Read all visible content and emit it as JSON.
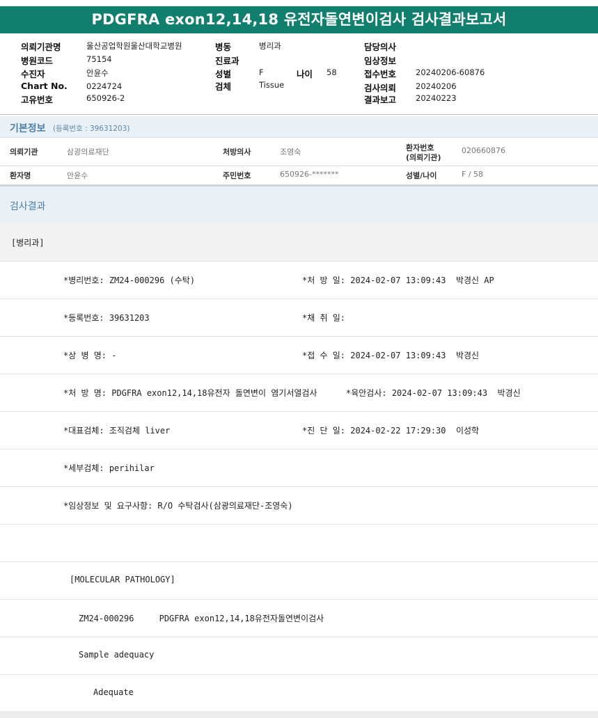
{
  "title": "PDGFRA exon12,14,18 유전자돌연변이검사 검사결과보고서",
  "header": {
    "col1": [
      {
        "label": "의뢰기관명",
        "value": "울산공업학원울산대학교병원"
      },
      {
        "label": "병원코드",
        "value": "75154"
      },
      {
        "label": "수진자",
        "value": "안윤수"
      },
      {
        "label": "Chart No.",
        "value": "0224724"
      },
      {
        "label": "고유번호",
        "value": "650926-2"
      }
    ],
    "col2": [
      {
        "label": "병동",
        "value": "병리과"
      },
      {
        "label": "진료과",
        "value": ""
      },
      {
        "label": "성별",
        "value": "F"
      },
      {
        "label": "검체",
        "value": "Tissue"
      }
    ],
    "age": {
      "label": "나이",
      "value": "58"
    },
    "col3": [
      {
        "label": "담당의사",
        "value": ""
      },
      {
        "label": "임상정보",
        "value": ""
      },
      {
        "label": "접수번호",
        "value": "20240206-60876"
      },
      {
        "label": "검사의뢰",
        "value": "20240206"
      },
      {
        "label": "결과보고",
        "value": "20240223"
      }
    ]
  },
  "basic": {
    "title": "기본정보",
    "reg": "(등록번호 : 39631203)",
    "row1": [
      {
        "label": "의뢰기관",
        "value": "삼광의료재단"
      },
      {
        "label": "처방의사",
        "value": "조영숙"
      },
      {
        "label_line1": "환자번호",
        "label_line2": "(의뢰기관)",
        "value": "020660876"
      }
    ],
    "row2": [
      {
        "label": "환자명",
        "value": "안윤수"
      },
      {
        "label": "주민번호",
        "value": "650926-*******"
      },
      {
        "label": "성별/나이",
        "value": "F / 58"
      }
    ]
  },
  "result": {
    "title": "검사결과",
    "dept": "[병리과]",
    "rows": [
      {
        "left": "*병리번호: ZM24-000296 (수탁)",
        "right": "*처 방 일: 2024-02-07 13:09:43  박경신 AP"
      },
      {
        "left": "*등록번호: 39631203",
        "right": "*채 취 일:"
      },
      {
        "left": "*상 병 명: -",
        "right": "*접 수 일: 2024-02-07 13:09:43  박경신"
      },
      {
        "left": "*처 방 명: PDGFRA exon12,14,18유전자 돌연변이 염기서열검사",
        "right": "*육안검사: 2024-02-07 13:09:43  박경신"
      },
      {
        "left": "*대표검체: 조직검체 liver",
        "right": "*진 단 일: 2024-02-22 17:29:30  이성학"
      },
      {
        "left": "*세부검체: perihilar",
        "right": ""
      },
      {
        "left": "*임상정보 및 요구사항: R/O 수탁검사(삼광의료재단-조영숙)",
        "right": ""
      }
    ],
    "mol_header": "[MOLECULAR PATHOLOGY]",
    "mol_line": "ZM24-000296     PDGFRA exon12,14,18유전자돌연변이검사",
    "sample_label": "Sample adequacy",
    "sample_value": "Adequate"
  }
}
